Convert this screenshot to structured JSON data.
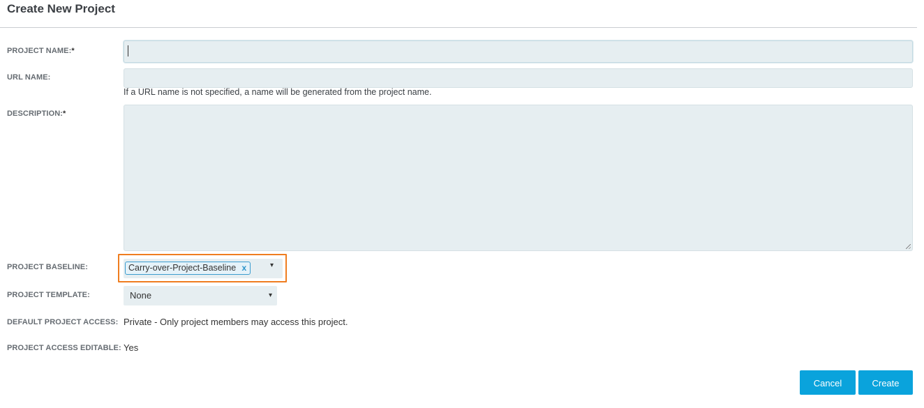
{
  "dialog": {
    "title": "Create New Project"
  },
  "form": {
    "project_name": {
      "label": "PROJECT NAME:",
      "required_mark": "*",
      "value": "",
      "placeholder": ""
    },
    "url_name": {
      "label": "URL NAME:",
      "value": "",
      "placeholder": "",
      "hint": "If a URL name is not specified, a name will be generated from the project name."
    },
    "description": {
      "label": "DESCRIPTION:",
      "required_mark": "*",
      "value": ""
    },
    "project_baseline": {
      "label": "PROJECT BASELINE:",
      "selected_tag": "Carry-over-Project-Baseline",
      "remove_glyph": "x",
      "dropdown_glyph": "▾",
      "highlight_color": "#ef7d1f"
    },
    "project_template": {
      "label": "PROJECT TEMPLATE:",
      "selected": "None",
      "dropdown_glyph": "▾"
    },
    "default_project_access": {
      "label": "DEFAULT PROJECT ACCESS:",
      "value": "Private - Only project members may access this project."
    },
    "project_access_editable": {
      "label": "PROJECT ACCESS EDITABLE:",
      "value": "Yes"
    }
  },
  "buttons": {
    "cancel": "Cancel",
    "create": "Create",
    "color": "#0aa3dc"
  }
}
